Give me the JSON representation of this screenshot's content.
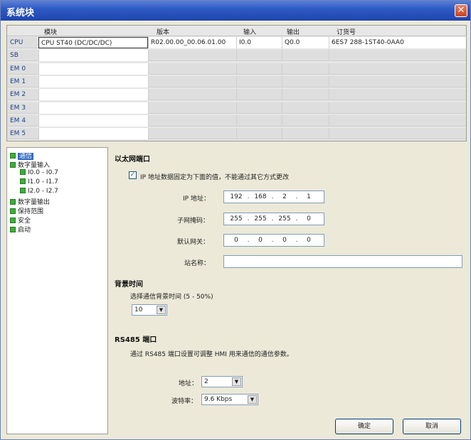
{
  "window": {
    "title": "系统块",
    "close_icon": "close-icon"
  },
  "table": {
    "headers": [
      "模块",
      "版本",
      "输入",
      "输出",
      "订货号"
    ],
    "rows": [
      {
        "label": "CPU",
        "module": "CPU ST40 (DC/DC/DC)",
        "version": "R02.00.00_00.06.01.00",
        "input": "I0.0",
        "output": "Q0.0",
        "order": "6ES7 288-1ST40-0AA0"
      },
      {
        "label": "SB",
        "module": "",
        "version": "",
        "input": "",
        "output": "",
        "order": ""
      },
      {
        "label": "EM 0",
        "module": "",
        "version": "",
        "input": "",
        "output": "",
        "order": ""
      },
      {
        "label": "EM 1",
        "module": "",
        "version": "",
        "input": "",
        "output": "",
        "order": ""
      },
      {
        "label": "EM 2",
        "module": "",
        "version": "",
        "input": "",
        "output": "",
        "order": ""
      },
      {
        "label": "EM 3",
        "module": "",
        "version": "",
        "input": "",
        "output": "",
        "order": ""
      },
      {
        "label": "EM 4",
        "module": "",
        "version": "",
        "input": "",
        "output": "",
        "order": ""
      },
      {
        "label": "EM 5",
        "module": "",
        "version": "",
        "input": "",
        "output": "",
        "order": ""
      }
    ]
  },
  "tree": [
    {
      "label": "通信"
    },
    {
      "label": "数字量输入"
    },
    {
      "label": "I0.0 - I0.7"
    },
    {
      "label": "I1.0 - I1.7"
    },
    {
      "label": "I2.0 - I2.7"
    },
    {
      "label": "数字量输出"
    },
    {
      "label": "保持范围"
    },
    {
      "label": "安全"
    },
    {
      "label": "启动"
    }
  ],
  "ethernet": {
    "title": "以太网端口",
    "fixed_ip_label": "IP 地址数据固定为下面的值，不能通过其它方式更改",
    "fixed_ip_checked": true,
    "ip_label": "IP 地址：",
    "ip": [
      "192",
      "168",
      "2",
      "1"
    ],
    "subnet_label": "子网掩码：",
    "subnet": [
      "255",
      "255",
      "255",
      "0"
    ],
    "gateway_label": "默认网关：",
    "gateway": [
      "0",
      "0",
      "0",
      "0"
    ],
    "station_label": "站名称：",
    "station_value": ""
  },
  "background": {
    "title": "背景时间",
    "desc": "选择通信背景时间 (5 - 50%)",
    "value": "10"
  },
  "rs485": {
    "title": "RS485 端口",
    "desc": "通过 RS485 端口设置可调整 HMI 用来通信的通信参数。",
    "addr_label": "地址：",
    "addr_value": "2",
    "baud_label": "波特率：",
    "baud_value": "9.6 Kbps"
  },
  "buttons": {
    "ok": "确定",
    "cancel": "取消"
  }
}
